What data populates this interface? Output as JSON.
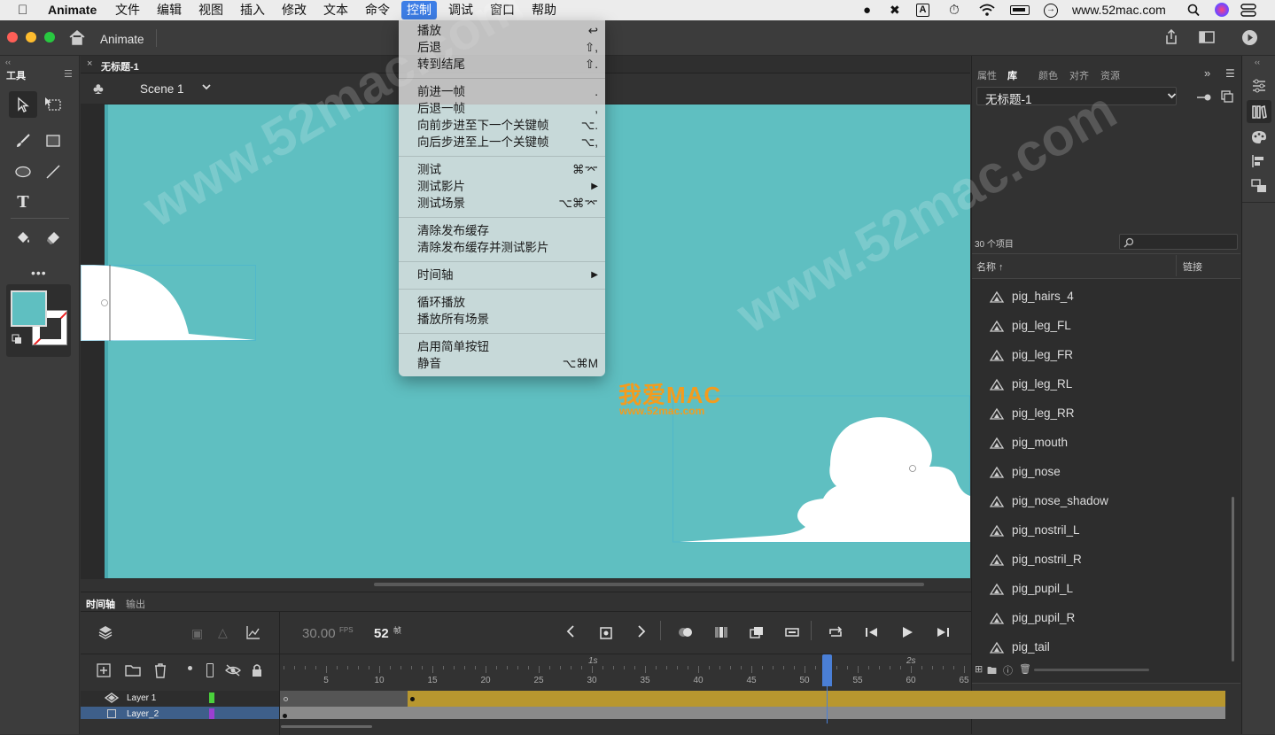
{
  "menubar": {
    "app_name": "Animate",
    "items": [
      "文件",
      "编辑",
      "视图",
      "插入",
      "修改",
      "文本",
      "命令",
      "控制",
      "调试",
      "窗口",
      "帮助"
    ],
    "active_item": "控制",
    "site": "www.52mac.com"
  },
  "appbar": {
    "home_tab": "Animate"
  },
  "tools": {
    "title": "工具"
  },
  "document": {
    "tab_title": "无标题-1",
    "scene": "Scene 1"
  },
  "control_menu": {
    "items": [
      {
        "label": "播放",
        "shortcut": "↩"
      },
      {
        "label": "后退",
        "shortcut": "⇧,"
      },
      {
        "label": "转到结尾",
        "shortcut": "⇧."
      },
      {
        "label": "前进一帧",
        "shortcut": "."
      },
      {
        "label": "后退一帧",
        "shortcut": ","
      },
      {
        "label": "向前步进至下一个关键帧",
        "shortcut": "⌥."
      },
      {
        "label": "向后步进至上一个关键帧",
        "shortcut": "⌥,"
      },
      {
        "label": "测试",
        "shortcut": "⌘⌤"
      },
      {
        "label": "测试影片",
        "shortcut": "▶"
      },
      {
        "label": "测试场景",
        "shortcut": "⌥⌘⌤"
      },
      {
        "label": "清除发布缓存",
        "shortcut": ""
      },
      {
        "label": "清除发布缓存并测试影片",
        "shortcut": ""
      },
      {
        "label": "时间轴",
        "shortcut": "▶"
      },
      {
        "label": "循环播放",
        "shortcut": ""
      },
      {
        "label": "播放所有场景",
        "shortcut": ""
      },
      {
        "label": "启用简单按钮",
        "shortcut": ""
      },
      {
        "label": "静音",
        "shortcut": "⌥⌘M"
      }
    ]
  },
  "watermark": {
    "brand": "我爱MAC",
    "url": "www.52mac.com",
    "diag": "www.52mac.com"
  },
  "library": {
    "tabs": [
      "属性",
      "库",
      "颜色",
      "对齐",
      "资源"
    ],
    "active_tab": "库",
    "doc": "无标题-1",
    "count": "30 个项目",
    "col_name": "名称 ↑",
    "col_link": "链接",
    "items": [
      "pig_hairs_4",
      "pig_leg_FL",
      "pig_leg_FR",
      "pig_leg_RL",
      "pig_leg_RR",
      "pig_mouth",
      "pig_nose",
      "pig_nose_shadow",
      "pig_nostril_L",
      "pig_nostril_R",
      "pig_pupil_L",
      "pig_pupil_R",
      "pig_tail"
    ]
  },
  "timeline": {
    "tabs": [
      "时间轴",
      "输出"
    ],
    "fps": "30.00",
    "fps_unit": "FPS",
    "frame": "52",
    "frame_unit": "帧",
    "sec_labels": [
      "1s",
      "2s"
    ],
    "frame_numbers": [
      "5",
      "10",
      "15",
      "20",
      "25",
      "30",
      "35",
      "40",
      "45",
      "50",
      "55",
      "60",
      "65"
    ],
    "layers": [
      "Layer 1",
      "Layer_2"
    ]
  },
  "colors": {
    "stage": "#5fbfc1",
    "accent": "#3d7ee6",
    "tween": "#b8972f"
  }
}
